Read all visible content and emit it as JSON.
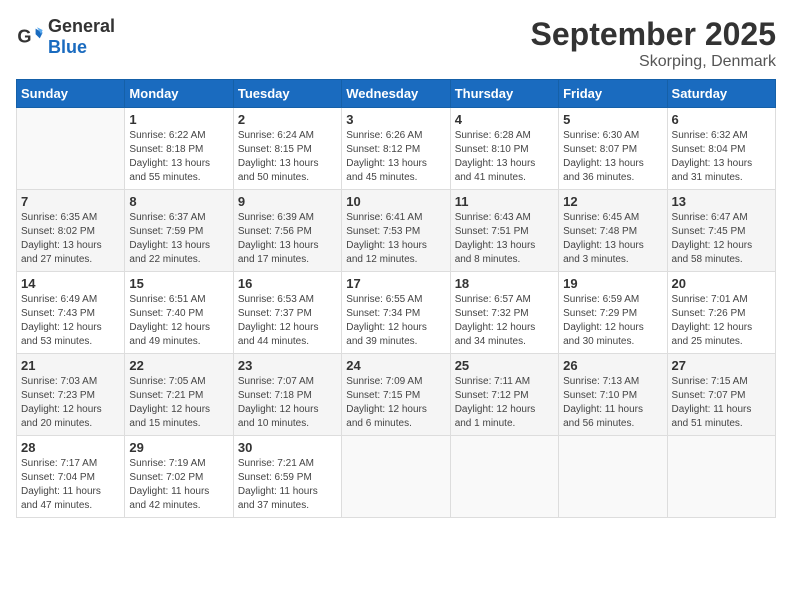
{
  "logo": {
    "general": "General",
    "blue": "Blue"
  },
  "title": "September 2025",
  "location": "Skorping, Denmark",
  "days_of_week": [
    "Sunday",
    "Monday",
    "Tuesday",
    "Wednesday",
    "Thursday",
    "Friday",
    "Saturday"
  ],
  "weeks": [
    [
      {
        "day": "",
        "info": ""
      },
      {
        "day": "1",
        "info": "Sunrise: 6:22 AM\nSunset: 8:18 PM\nDaylight: 13 hours\nand 55 minutes."
      },
      {
        "day": "2",
        "info": "Sunrise: 6:24 AM\nSunset: 8:15 PM\nDaylight: 13 hours\nand 50 minutes."
      },
      {
        "day": "3",
        "info": "Sunrise: 6:26 AM\nSunset: 8:12 PM\nDaylight: 13 hours\nand 45 minutes."
      },
      {
        "day": "4",
        "info": "Sunrise: 6:28 AM\nSunset: 8:10 PM\nDaylight: 13 hours\nand 41 minutes."
      },
      {
        "day": "5",
        "info": "Sunrise: 6:30 AM\nSunset: 8:07 PM\nDaylight: 13 hours\nand 36 minutes."
      },
      {
        "day": "6",
        "info": "Sunrise: 6:32 AM\nSunset: 8:04 PM\nDaylight: 13 hours\nand 31 minutes."
      }
    ],
    [
      {
        "day": "7",
        "info": "Sunrise: 6:35 AM\nSunset: 8:02 PM\nDaylight: 13 hours\nand 27 minutes."
      },
      {
        "day": "8",
        "info": "Sunrise: 6:37 AM\nSunset: 7:59 PM\nDaylight: 13 hours\nand 22 minutes."
      },
      {
        "day": "9",
        "info": "Sunrise: 6:39 AM\nSunset: 7:56 PM\nDaylight: 13 hours\nand 17 minutes."
      },
      {
        "day": "10",
        "info": "Sunrise: 6:41 AM\nSunset: 7:53 PM\nDaylight: 13 hours\nand 12 minutes."
      },
      {
        "day": "11",
        "info": "Sunrise: 6:43 AM\nSunset: 7:51 PM\nDaylight: 13 hours\nand 8 minutes."
      },
      {
        "day": "12",
        "info": "Sunrise: 6:45 AM\nSunset: 7:48 PM\nDaylight: 13 hours\nand 3 minutes."
      },
      {
        "day": "13",
        "info": "Sunrise: 6:47 AM\nSunset: 7:45 PM\nDaylight: 12 hours\nand 58 minutes."
      }
    ],
    [
      {
        "day": "14",
        "info": "Sunrise: 6:49 AM\nSunset: 7:43 PM\nDaylight: 12 hours\nand 53 minutes."
      },
      {
        "day": "15",
        "info": "Sunrise: 6:51 AM\nSunset: 7:40 PM\nDaylight: 12 hours\nand 49 minutes."
      },
      {
        "day": "16",
        "info": "Sunrise: 6:53 AM\nSunset: 7:37 PM\nDaylight: 12 hours\nand 44 minutes."
      },
      {
        "day": "17",
        "info": "Sunrise: 6:55 AM\nSunset: 7:34 PM\nDaylight: 12 hours\nand 39 minutes."
      },
      {
        "day": "18",
        "info": "Sunrise: 6:57 AM\nSunset: 7:32 PM\nDaylight: 12 hours\nand 34 minutes."
      },
      {
        "day": "19",
        "info": "Sunrise: 6:59 AM\nSunset: 7:29 PM\nDaylight: 12 hours\nand 30 minutes."
      },
      {
        "day": "20",
        "info": "Sunrise: 7:01 AM\nSunset: 7:26 PM\nDaylight: 12 hours\nand 25 minutes."
      }
    ],
    [
      {
        "day": "21",
        "info": "Sunrise: 7:03 AM\nSunset: 7:23 PM\nDaylight: 12 hours\nand 20 minutes."
      },
      {
        "day": "22",
        "info": "Sunrise: 7:05 AM\nSunset: 7:21 PM\nDaylight: 12 hours\nand 15 minutes."
      },
      {
        "day": "23",
        "info": "Sunrise: 7:07 AM\nSunset: 7:18 PM\nDaylight: 12 hours\nand 10 minutes."
      },
      {
        "day": "24",
        "info": "Sunrise: 7:09 AM\nSunset: 7:15 PM\nDaylight: 12 hours\nand 6 minutes."
      },
      {
        "day": "25",
        "info": "Sunrise: 7:11 AM\nSunset: 7:12 PM\nDaylight: 12 hours\nand 1 minute."
      },
      {
        "day": "26",
        "info": "Sunrise: 7:13 AM\nSunset: 7:10 PM\nDaylight: 11 hours\nand 56 minutes."
      },
      {
        "day": "27",
        "info": "Sunrise: 7:15 AM\nSunset: 7:07 PM\nDaylight: 11 hours\nand 51 minutes."
      }
    ],
    [
      {
        "day": "28",
        "info": "Sunrise: 7:17 AM\nSunset: 7:04 PM\nDaylight: 11 hours\nand 47 minutes."
      },
      {
        "day": "29",
        "info": "Sunrise: 7:19 AM\nSunset: 7:02 PM\nDaylight: 11 hours\nand 42 minutes."
      },
      {
        "day": "30",
        "info": "Sunrise: 7:21 AM\nSunset: 6:59 PM\nDaylight: 11 hours\nand 37 minutes."
      },
      {
        "day": "",
        "info": ""
      },
      {
        "day": "",
        "info": ""
      },
      {
        "day": "",
        "info": ""
      },
      {
        "day": "",
        "info": ""
      }
    ]
  ]
}
